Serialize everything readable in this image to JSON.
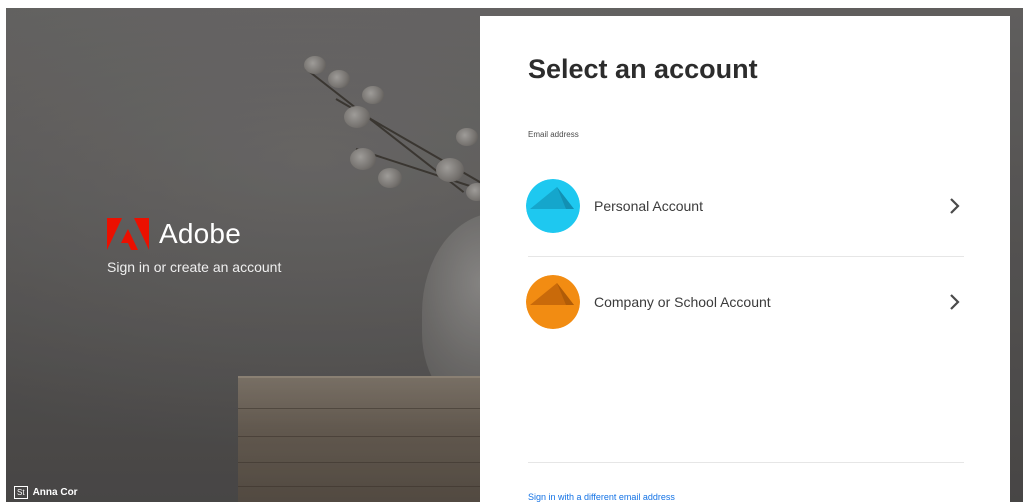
{
  "background": {
    "brand_name": "Adobe",
    "tagline": "Sign in or create an account",
    "credit_badge": "St",
    "credit_name": "Anna Cor",
    "brand_color": "#eb1000"
  },
  "panel": {
    "title": "Select an account",
    "email_label": "Email address",
    "accounts": [
      {
        "label": "Personal Account",
        "icon": "personal-account-icon",
        "color": "#1ec8f0"
      },
      {
        "label": "Company or School Account",
        "icon": "company-account-icon",
        "color": "#f0850e"
      }
    ],
    "alt_link": "Sign in with a different email address",
    "link_color": "#1473e6"
  }
}
